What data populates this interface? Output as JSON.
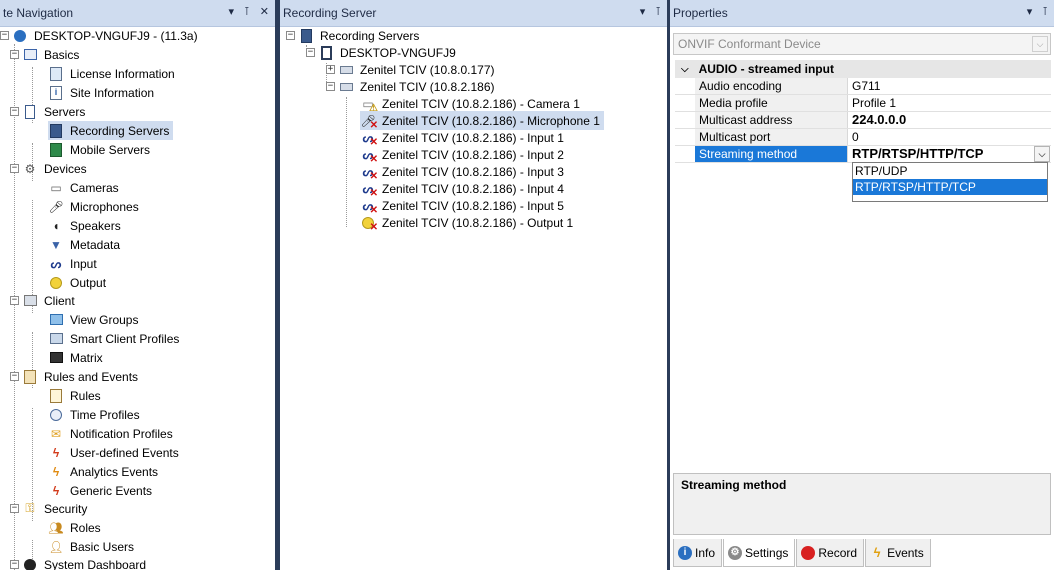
{
  "left_pane": {
    "title": "te Navigation",
    "controls": [
      "▾",
      "⊺",
      "✕"
    ],
    "items": [
      {
        "label": "DESKTOP-VNGUFJ9 - (11.3a)",
        "icon": "site-icon"
      },
      {
        "label": "Basics",
        "icon": "book-icon"
      },
      {
        "label": "License Information",
        "icon": "license-icon"
      },
      {
        "label": "Site Information",
        "icon": "info-doc-icon"
      },
      {
        "label": "Servers",
        "icon": "server-icon"
      },
      {
        "label": "Recording Servers",
        "icon": "recording-server-icon"
      },
      {
        "label": "Mobile Servers",
        "icon": "mobile-server-icon"
      },
      {
        "label": "Devices",
        "icon": "devices-icon"
      },
      {
        "label": "Cameras",
        "icon": "camera-icon"
      },
      {
        "label": "Microphones",
        "icon": "microphone-icon"
      },
      {
        "label": "Speakers",
        "icon": "speaker-icon"
      },
      {
        "label": "Metadata",
        "icon": "metadata-icon"
      },
      {
        "label": "Input",
        "icon": "input-icon"
      },
      {
        "label": "Output",
        "icon": "output-icon"
      },
      {
        "label": "Client",
        "icon": "client-icon"
      },
      {
        "label": "View Groups",
        "icon": "view-groups-icon"
      },
      {
        "label": "Smart Client Profiles",
        "icon": "profiles-icon"
      },
      {
        "label": "Matrix",
        "icon": "matrix-icon"
      },
      {
        "label": "Rules and Events",
        "icon": "rules-events-icon"
      },
      {
        "label": "Rules",
        "icon": "rules-icon"
      },
      {
        "label": "Time Profiles",
        "icon": "clock-icon"
      },
      {
        "label": "Notification Profiles",
        "icon": "envelope-icon"
      },
      {
        "label": "User-defined Events",
        "icon": "event-icon"
      },
      {
        "label": "Analytics Events",
        "icon": "analytics-event-icon"
      },
      {
        "label": "Generic Events",
        "icon": "generic-event-icon"
      },
      {
        "label": "Security",
        "icon": "security-icon"
      },
      {
        "label": "Roles",
        "icon": "roles-icon"
      },
      {
        "label": "Basic Users",
        "icon": "user-icon"
      },
      {
        "label": "System Dashboard",
        "icon": "dashboard-icon"
      }
    ]
  },
  "mid_pane": {
    "title": "Recording Server",
    "controls": [
      "▾",
      "⊺"
    ],
    "items": [
      {
        "label": "Recording Servers"
      },
      {
        "label": "DESKTOP-VNGUFJ9"
      },
      {
        "label": "Zenitel TCIV (10.8.0.177)"
      },
      {
        "label": "Zenitel TCIV (10.8.2.186)"
      },
      {
        "label": "Zenitel TCIV (10.8.2.186) - Camera 1"
      },
      {
        "label": "Zenitel TCIV (10.8.2.186) - Microphone 1"
      },
      {
        "label": "Zenitel TCIV (10.8.2.186) - Input 1"
      },
      {
        "label": "Zenitel TCIV (10.8.2.186) - Input 2"
      },
      {
        "label": "Zenitel TCIV (10.8.2.186) - Input 3"
      },
      {
        "label": "Zenitel TCIV (10.8.2.186) - Input 4"
      },
      {
        "label": "Zenitel TCIV (10.8.2.186) - Input 5"
      },
      {
        "label": "Zenitel TCIV (10.8.2.186) - Output 1"
      }
    ]
  },
  "properties": {
    "title": "Properties",
    "controls": [
      "▾",
      "⊺"
    ],
    "device_combo": "ONVIF Conformant Device",
    "category": "AUDIO - streamed input",
    "rows": [
      {
        "name": "Audio encoding",
        "value": "G711"
      },
      {
        "name": "Media profile",
        "value": "Profile 1"
      },
      {
        "name": "Multicast address",
        "value": "224.0.0.0"
      },
      {
        "name": "Multicast port",
        "value": "0"
      },
      {
        "name": "Streaming method",
        "value": "RTP/RTSP/HTTP/TCP"
      }
    ],
    "dropdown_options": [
      "RTP/UDP",
      "RTP/RTSP/HTTP/TCP"
    ],
    "description_title": "Streaming method",
    "tabs": [
      {
        "label": "Info",
        "icon": "info-icon"
      },
      {
        "label": "Settings",
        "icon": "settings-icon"
      },
      {
        "label": "Record",
        "icon": "record-icon"
      },
      {
        "label": "Events",
        "icon": "events-icon"
      }
    ]
  },
  "colors": {
    "header_bg": "#cfdcef",
    "selection_bg": "#cfdcef",
    "highlight": "#1a78d8",
    "splitter": "#2b3c59"
  }
}
